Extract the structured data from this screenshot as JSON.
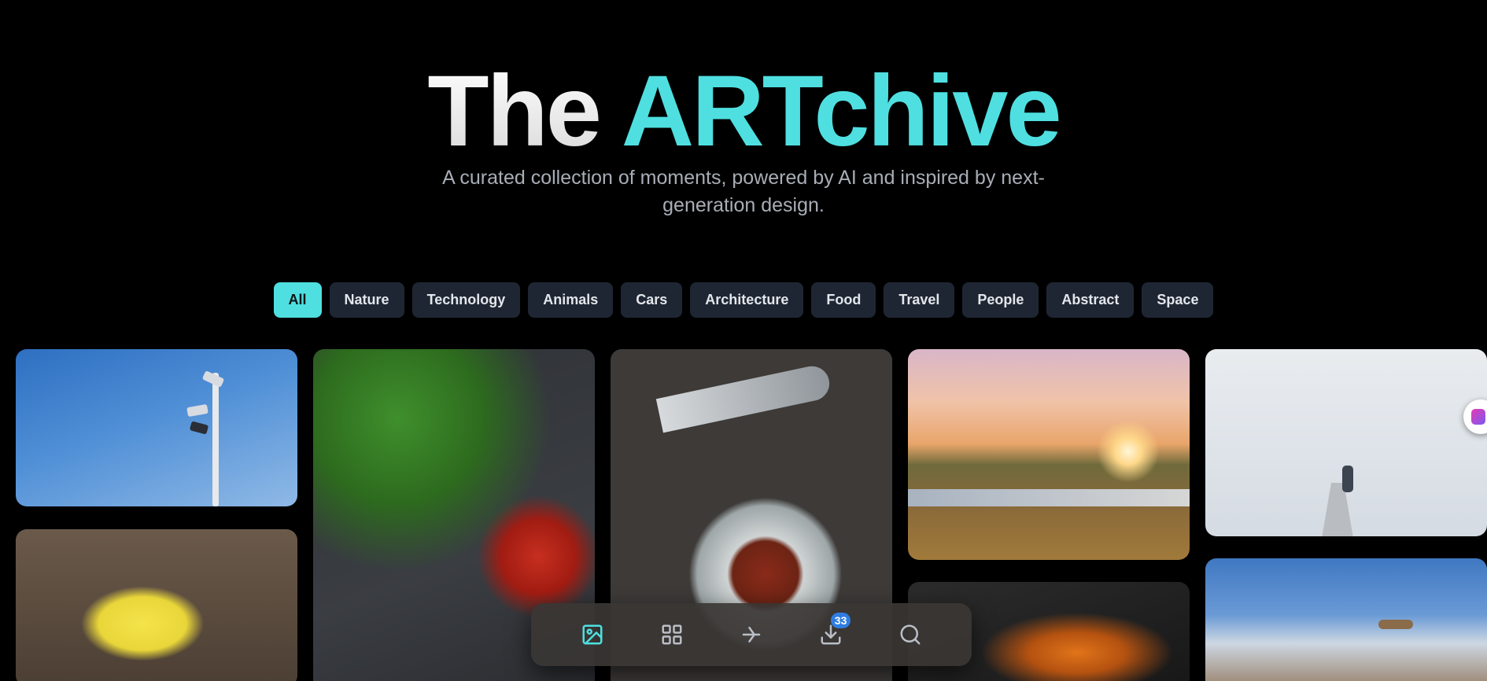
{
  "hero": {
    "title_part1": "The",
    "title_part2": "ARTchive",
    "subtitle": "A curated collection of moments, powered by AI and inspired by next-generation design."
  },
  "filters": [
    "All",
    "Nature",
    "Technology",
    "Animals",
    "Cars",
    "Architecture",
    "Food",
    "Travel",
    "People",
    "Abstract",
    "Space"
  ],
  "active_filter": "All",
  "gallery": [
    {
      "subject": "security camera pole against blue sky"
    },
    {
      "subject": "duckling on dirt"
    },
    {
      "subject": "basil leaves and cherry tomatoes"
    },
    {
      "subject": "knife and skewers on plate"
    },
    {
      "subject": "sunset over hills and lake"
    },
    {
      "subject": "orange coiled cable"
    },
    {
      "subject": "person on foggy pier"
    },
    {
      "subject": "cowboy with horse"
    }
  ],
  "dock": {
    "items": [
      {
        "icon": "image-icon",
        "active": true
      },
      {
        "icon": "grid-icon",
        "active": false
      },
      {
        "icon": "airplane-icon",
        "active": false
      },
      {
        "icon": "download-icon",
        "active": false,
        "badge": "33"
      },
      {
        "icon": "search-icon",
        "active": false
      }
    ]
  },
  "colors": {
    "accent": "#4fdfe0",
    "chip_bg": "#1f2633",
    "badge": "#2f7de1"
  }
}
